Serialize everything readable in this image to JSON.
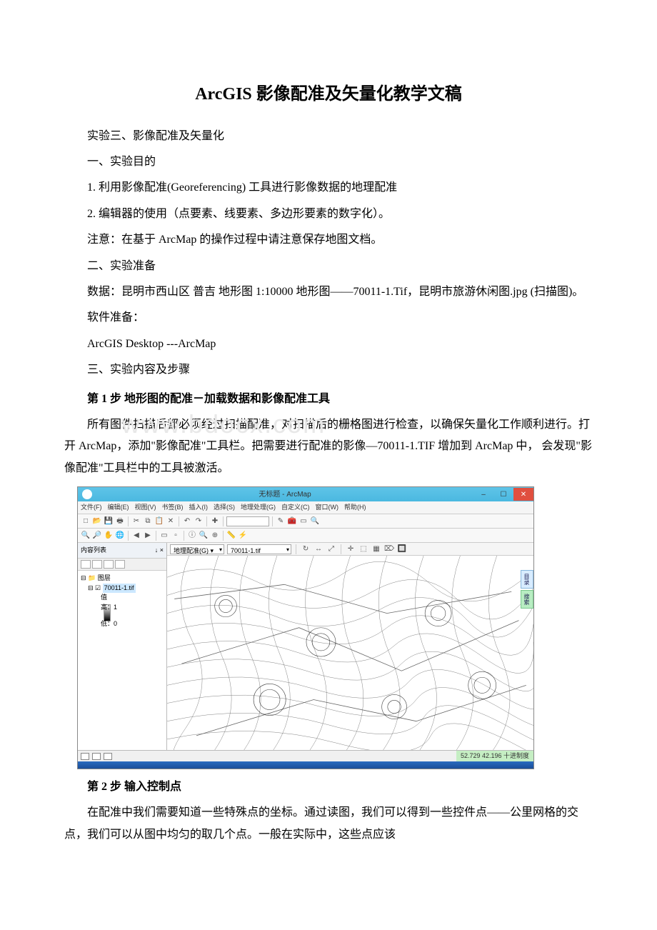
{
  "title": "ArcGIS 影像配准及矢量化教学文稿",
  "p1": "实验三、影像配准及矢量化",
  "p2": "一、实验目的",
  "p3": "1. 利用影像配准(Georeferencing) 工具进行影像数据的地理配准",
  "p4": "2. 编辑器的使用（点要素、线要素、多边形要素的数字化）。",
  "p5": "注意：在基于 ArcMap 的操作过程中请注意保存地图文档。",
  "p6": "二、实验准备",
  "p7": "数据：昆明市西山区 普吉 地形图 1:10000 地形图——70011-1.Tif，昆明市旅游休闲图.jpg (扫描图)。",
  "p8": "软件准备：",
  "p9": " ArcGIS Desktop ---ArcMap",
  "p10": "三、实验内容及步骤",
  "step1": "第 1 步 地形图的配准－加载数据和影像配准工具",
  "step1_body": "所有图件扫描后都必须经过扫描配准，对扫描后的栅格图进行检查，以确保矢量化工作顺利进行。打开 ArcMap，添加\"影像配准\"工具栏。把需要进行配准的影像—70011-1.TIF 增加到 ArcMap 中， 会发现\"影像配准\"工具栏中的工具被激活。",
  "step2": "第 2 步 输入控制点",
  "step2_body": "在配准中我们需要知道一些特殊点的坐标。通过读图，我们可以得到一些控件点——公里网格的交点，我们可以从图中均匀的取几个点。一般在实际中，这些点应该",
  "watermark": "www.bdocx.com",
  "arcmap": {
    "window_title": "无标题 - ArcMap",
    "menu": {
      "file": "文件(F)",
      "edit": "编辑(E)",
      "view": "视图(V)",
      "bookmarks": "书签(B)",
      "insert": "插入(I)",
      "selection": "选择(S)",
      "geoprocessing": "地理处理(G)",
      "customize": "自定义(C)",
      "windows": "窗口(W)",
      "help": "帮助(H)"
    },
    "toc": {
      "header": "内容列表",
      "pin": "↓ ×",
      "root": "图层",
      "layer": "70011-1.tif",
      "value_label": "值",
      "high": "高：1",
      "low": "低：0"
    },
    "georef": {
      "label": "地理配准(G) ▾",
      "layer": "70011-1.tif"
    },
    "right_tabs": {
      "catalog": "目录",
      "search": "搜索"
    },
    "status": {
      "coords": "52.729 42.196 十进制度"
    }
  }
}
